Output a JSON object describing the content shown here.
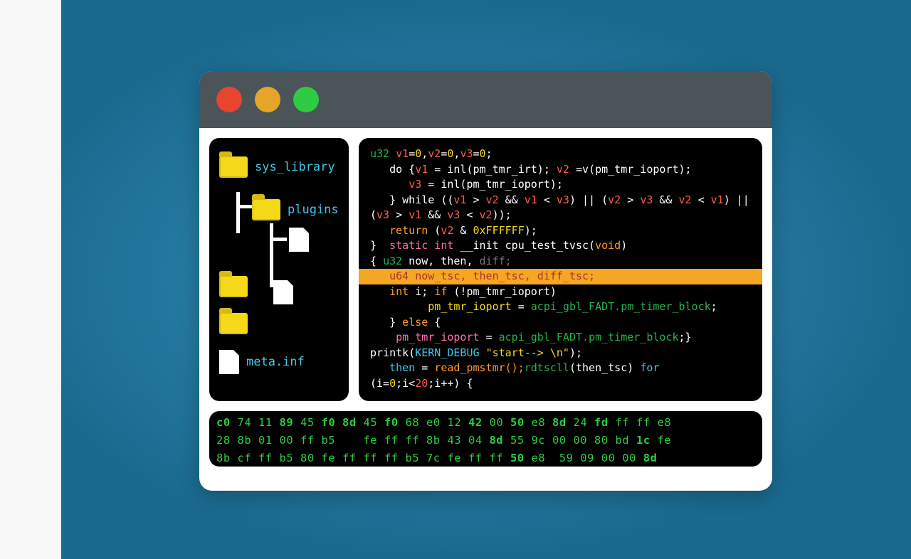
{
  "sidebar": {
    "items": [
      {
        "label": "sys_library"
      },
      {
        "label": "plugins"
      },
      {
        "label": "meta.inf"
      }
    ]
  },
  "code": {
    "l1_kw": "u32 ",
    "l1_v1": "v1",
    "l1_eq": "=",
    "l1_n0a": "0",
    "l1_c1": ",",
    "l1_v2": "v2",
    "l1_n0b": "0",
    "l1_c2": ",",
    "l1_v3": "v3",
    "l1_n0c": "0",
    "l1_sc": ";",
    "l2_a": "   do {",
    "l2_v1": "v1",
    "l2_b": " = inl(pm_tmr_irt); ",
    "l2_v2": "v2",
    "l2_c": " =v(pm_tmr_ioport);",
    "l3_a": "      ",
    "l3_v3": "v3",
    "l3_b": " = inl(pm_tmr_ioport);",
    "l4_a": "   } while ((",
    "l4_v1": "v1",
    "l4_b": " > ",
    "l4_v2": "v2",
    "l4_c": " && ",
    "l4_v1b": "v1",
    "l4_d": " < ",
    "l4_v3": "v3",
    "l4_e": ") || (",
    "l4_v2b": "v2",
    "l4_f": " > ",
    "l4_v3b": "v3",
    "l4_g": " && ",
    "l4_v2c": "v2",
    "l4_h": " < ",
    "l4_v1c": "v1",
    "l4_i": ") || (",
    "l4_v3c": "v3",
    "l4_j": " > ",
    "l4_v1d": "v1",
    "l4_k": " && ",
    "l4_v3d": "v3",
    "l4_l": " < ",
    "l4_v2d": "v2",
    "l4_m": "));",
    "l5_a": "   ",
    "l5_ret": "return",
    "l5_b": " (",
    "l5_v2": "v2",
    "l5_c": " & ",
    "l5_hex": "0xFFFFFF",
    "l5_d": ");",
    "l6_a": "}  ",
    "l6_static": "static int",
    "l6_b": " __init cpu_test_tvsc(",
    "l6_void": "void",
    "l6_c": ")",
    "l7_a": "{ ",
    "l7_u32": "u32",
    "l7_b": " now, then, ",
    "l7_grey": "diff;",
    "l8_hl": "   u64 now_tsc, then_tsc, diff_tsc;",
    "l9_a": "   ",
    "l9_int": "int",
    "l9_b": " i; ",
    "l9_if": "if",
    "l9_c": " (!pm_tmr_ioport)",
    "l10_a": "         ",
    "l10_lhs": "pm_tmr_ioport",
    "l10_b": " = ",
    "l10_rhs": "acpi_gbl_FADT.pm_timer_block",
    "l10_c": ";",
    "l11_a": "   } ",
    "l11_else": "else",
    "l11_b": " {",
    "l12_a": "    ",
    "l12_lhs": "pm_tmr_ioport",
    "l12_b": " = ",
    "l12_rhs": "acpi_gbl_FADT.pm_timer_block",
    "l12_c": ";}",
    "l13_a": "printk(",
    "l13_kern": "KERN_DEBUG",
    "l13_b": " ",
    "l13_str": "\"start--> \\n\"",
    "l13_c": ");",
    "l14_a": "   ",
    "l14_then": "then",
    "l14_b": " = ",
    "l14_fn": "read_pmstmr();",
    "l14_rd": "rdtscll",
    "l14_c": "(then_tsc) ",
    "l14_for": "for",
    "l15_a": "(i=",
    "l15_n0": "0",
    "l15_b": ";i<",
    "l15_n20": "20",
    "l15_c": ";i++) {"
  },
  "hex": {
    "row1": "c0 74 11 89 45 f0 8d 45 f0 68 e0 12 42 00 50 e8 8d 24 fd ff ff e8",
    "row2": "28 8b 01 00 ff b5    fe ff ff 8b 43 04 8d 55 9c 00 00 80 bd 1c fe",
    "row3": "8b cf ff b5 80 fe ff ff ff b5 7c fe ff ff 50 e8  59 09 00 00 8d"
  }
}
